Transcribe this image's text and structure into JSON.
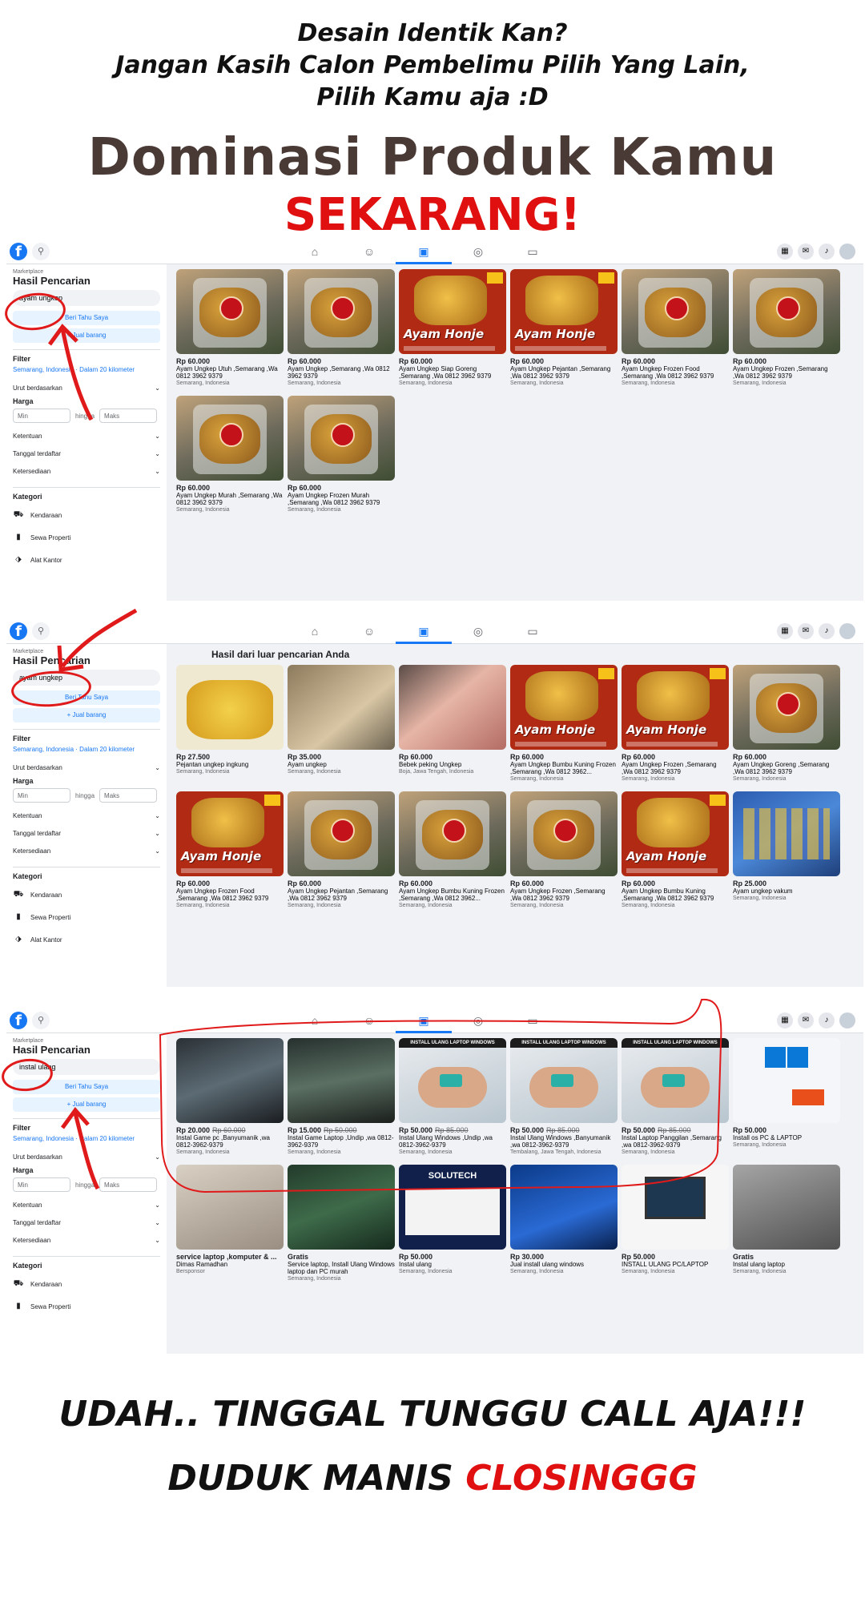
{
  "headline": {
    "line1": "Desain Identik Kan?",
    "line2": "Jangan Kasih Calon Pembelimu Pilih Yang Lain,",
    "line3": "Pilih Kamu aja :D",
    "big": "Dominasi Produk Kamu",
    "red": "SEKARANG!"
  },
  "footer": {
    "line1": "UDAH.. TINGGAL TUNGGU CALL AJA!!!",
    "line2_black": "DUDUK MANIS ",
    "line2_red": "CLOSINGGG"
  },
  "colors": {
    "accent": "#1877f2",
    "red": "#e01010",
    "brown": "#4a3a36"
  },
  "shots": [
    {
      "sidebar": {
        "crumb": "Marketplace",
        "title": "Hasil Pencarian",
        "search": "ayam ungkep",
        "notify": "Beri Tahu Saya",
        "sell": "+ Jual barang",
        "filter": "Filter",
        "location": "Semarang, Indonesia · Dalam 20 kilometer",
        "sort": "Urut berdasarkan",
        "price": "Harga",
        "min": "Min",
        "to": "hingga",
        "max": "Maks",
        "condition": "Ketentuan",
        "listed": "Tanggal terdaftar",
        "availability": "Ketersediaan",
        "categories": "Kategori",
        "cats": [
          "Kendaraan",
          "Sewa Properti",
          "Alat Kantor"
        ]
      },
      "section_title": "",
      "items": [
        {
          "img": "bag",
          "price": "Rp 60.000",
          "old": "",
          "title": "Ayam Ungkep Utuh ,Semarang ,Wa 0812 3962 9379",
          "loc": "Semarang, Indonesia"
        },
        {
          "img": "bag",
          "price": "Rp 60.000",
          "old": "",
          "title": "Ayam Ungkep ,Semarang ,Wa 0812 3962 9379",
          "loc": "Semarang, Indonesia"
        },
        {
          "img": "poster",
          "price": "Rp 60.000",
          "old": "",
          "title": "Ayam Ungkep Siap Goreng ,Semarang ,Wa 0812 3962 9379",
          "loc": "Semarang, Indonesia"
        },
        {
          "img": "poster",
          "price": "Rp 60.000",
          "old": "",
          "title": "Ayam Ungkep Pejantan ,Semarang ,Wa 0812 3962 9379",
          "loc": "Semarang, Indonesia"
        },
        {
          "img": "bag",
          "price": "Rp 60.000",
          "old": "",
          "title": "Ayam Ungkep Frozen Food ,Semarang ,Wa 0812 3962 9379",
          "loc": "Semarang, Indonesia"
        },
        {
          "img": "bag",
          "price": "Rp 60.000",
          "old": "",
          "title": "Ayam Ungkep Frozen ,Semarang ,Wa 0812 3962 9379",
          "loc": "Semarang, Indonesia"
        },
        {
          "img": "bag",
          "price": "Rp 60.000",
          "old": "",
          "title": "Ayam Ungkep Murah ,Semarang ,Wa 0812 3962 9379",
          "loc": "Semarang, Indonesia"
        },
        {
          "img": "bag",
          "price": "Rp 60.000",
          "old": "",
          "title": "Ayam Ungkep Frozen Murah ,Semarang ,Wa 0812 3962 9379",
          "loc": "Semarang, Indonesia"
        }
      ]
    },
    {
      "sidebar": {
        "crumb": "Marketplace",
        "title": "Hasil Pencarian",
        "search": "ayam ungkep",
        "notify": "Beri Tahu Saya",
        "sell": "+ Jual barang",
        "filter": "Filter",
        "location": "Semarang, Indonesia · Dalam 20 kilometer",
        "sort": "Urut berdasarkan",
        "price": "Harga",
        "min": "Min",
        "to": "hingga",
        "max": "Maks",
        "condition": "Ketentuan",
        "listed": "Tanggal terdaftar",
        "availability": "Ketersediaan",
        "categories": "Kategori",
        "cats": [
          "Kendaraan",
          "Sewa Properti",
          "Alat Kantor"
        ]
      },
      "section_title": "Hasil dari luar pencarian Anda",
      "items": [
        {
          "img": "yellow",
          "price": "Rp 27.500",
          "old": "",
          "title": "Pejantan ungkep ingkung",
          "loc": "Semarang, Indonesia"
        },
        {
          "img": "pale",
          "price": "Rp 35.000",
          "old": "",
          "title": "Ayam ungkep",
          "loc": "Semarang, Indonesia"
        },
        {
          "img": "raw",
          "price": "Rp 60.000",
          "old": "",
          "title": "Bebek peking Ungkep",
          "loc": "Boja, Jawa Tengah, Indonesia"
        },
        {
          "img": "poster",
          "price": "Rp 60.000",
          "old": "",
          "title": "Ayam Ungkep Bumbu Kuning Frozen ,Semarang ,Wa 0812 3962...",
          "loc": "Semarang, Indonesia"
        },
        {
          "img": "poster",
          "price": "Rp 60.000",
          "old": "",
          "title": "Ayam Ungkep Frozen ,Semarang ,Wa 0812 3962 9379",
          "loc": "Semarang, Indonesia"
        },
        {
          "img": "bag",
          "price": "Rp 60.000",
          "old": "",
          "title": "Ayam Ungkep Goreng ,Semarang ,Wa 0812 3962 9379",
          "loc": "Semarang, Indonesia"
        },
        {
          "img": "poster",
          "price": "Rp 60.000",
          "old": "",
          "title": "Ayam Ungkep Frozen Food ,Semarang ,Wa 0812 3962 9379",
          "loc": "Semarang, Indonesia"
        },
        {
          "img": "bag",
          "price": "Rp 60.000",
          "old": "",
          "title": "Ayam Ungkep Pejantan ,Semarang ,Wa 0812 3962 9379",
          "loc": "Semarang, Indonesia"
        },
        {
          "img": "bag",
          "price": "Rp 60.000",
          "old": "",
          "title": "Ayam Ungkep Bumbu Kuning Frozen ,Semarang ,Wa 0812 3962...",
          "loc": "Semarang, Indonesia"
        },
        {
          "img": "bag",
          "price": "Rp 60.000",
          "old": "",
          "title": "Ayam Ungkep Frozen ,Semarang ,Wa 0812 3962 9379",
          "loc": "Semarang, Indonesia"
        },
        {
          "img": "poster",
          "price": "Rp 60.000",
          "old": "",
          "title": "Ayam Ungkep Bumbu Kuning ,Semarang ,Wa 0812 3962 9379",
          "loc": "Semarang, Indonesia"
        },
        {
          "img": "blue",
          "price": "Rp 25.000",
          "old": "",
          "title": "Ayam ungkep vakum",
          "loc": "Semarang, Indonesia"
        }
      ]
    },
    {
      "sidebar": {
        "crumb": "Marketplace",
        "title": "Hasil Pencarian",
        "search": "instal ulang",
        "notify": "Beri Tahu Saya",
        "sell": "+ Jual barang",
        "filter": "Filter",
        "location": "Semarang, Indonesia · Dalam 20 kilometer",
        "sort": "Urut berdasarkan",
        "price": "Harga",
        "min": "Min",
        "to": "hingga",
        "max": "Maks",
        "condition": "Ketentuan",
        "listed": "Tanggal terdaftar",
        "availability": "Ketersediaan",
        "categories": "Kategori",
        "cats": [
          "Kendaraan",
          "Sewa Properti"
        ]
      },
      "section_title": "",
      "items": [
        {
          "img": "game",
          "price": "Rp 20.000",
          "old": "Rp 60.000",
          "title": "Instal Game pc ,Banyumanik ,wa 0812-3962-9379",
          "loc": "Semarang, Indonesia"
        },
        {
          "img": "city",
          "price": "Rp 15.000",
          "old": "Rp 50.000",
          "title": "Instal Game Laptop ,Undip ,wa 0812-3962-9379",
          "loc": "Semarang, Indonesia"
        },
        {
          "img": "usb",
          "price": "Rp 50.000",
          "old": "Rp 85.000",
          "title": "Instal Ulang Windows ,Undip ,wa 0812-3962-9379",
          "loc": "Semarang, Indonesia"
        },
        {
          "img": "usb",
          "price": "Rp 50.000",
          "old": "Rp 85.000",
          "title": "Instal Ulang Windows ,Banyumanik ,wa 0812-3962-9379",
          "loc": "Tembalang, Jawa Tengah, Indonesia"
        },
        {
          "img": "usb",
          "price": "Rp 50.000",
          "old": "Rp 85.000",
          "title": "Instal Laptop Panggilan ,Semarang ,wa 0812-3962-9379",
          "loc": "Semarang, Indonesia"
        },
        {
          "img": "win",
          "price": "Rp 50.000",
          "old": "",
          "title": "Install os PC & LAPTOP",
          "loc": "Semarang, Indonesia"
        },
        {
          "img": "desk",
          "price": "service laptop ,komputer & ...",
          "old": "",
          "title": "Dimas Ramadhan",
          "loc": "Bersponsor"
        },
        {
          "img": "board",
          "price": "Gratis",
          "old": "",
          "title": "Service laptop, Install Ulang Windows laptop dan PC murah",
          "loc": "Semarang, Indonesia"
        },
        {
          "img": "solu",
          "price": "Rp 50.000",
          "old": "",
          "title": "Instal ulang",
          "loc": "Semarang, Indonesia"
        },
        {
          "img": "screen",
          "price": "Rp 30.000",
          "old": "",
          "title": "Jual install ulang windows",
          "loc": "Semarang, Indonesia"
        },
        {
          "img": "monitor",
          "price": "Rp 50.000",
          "old": "",
          "title": "INSTALL ULANG PC/LAPTOP",
          "loc": "Semarang, Indonesia"
        },
        {
          "img": "laptop",
          "price": "Gratis",
          "old": "",
          "title": "Instal ulang laptop",
          "loc": "Semarang, Indonesia"
        }
      ]
    }
  ],
  "poster_text": {
    "brand": "Ayam Honje",
    "usb_bar": "INSTALL ULANG LAPTOP WINDOWS",
    "solu": "SOLUTECH",
    "win": "Windows"
  },
  "nav_icons": [
    "home-icon",
    "friends-icon",
    "marketplace-icon",
    "groups-icon",
    "gaming-icon"
  ]
}
